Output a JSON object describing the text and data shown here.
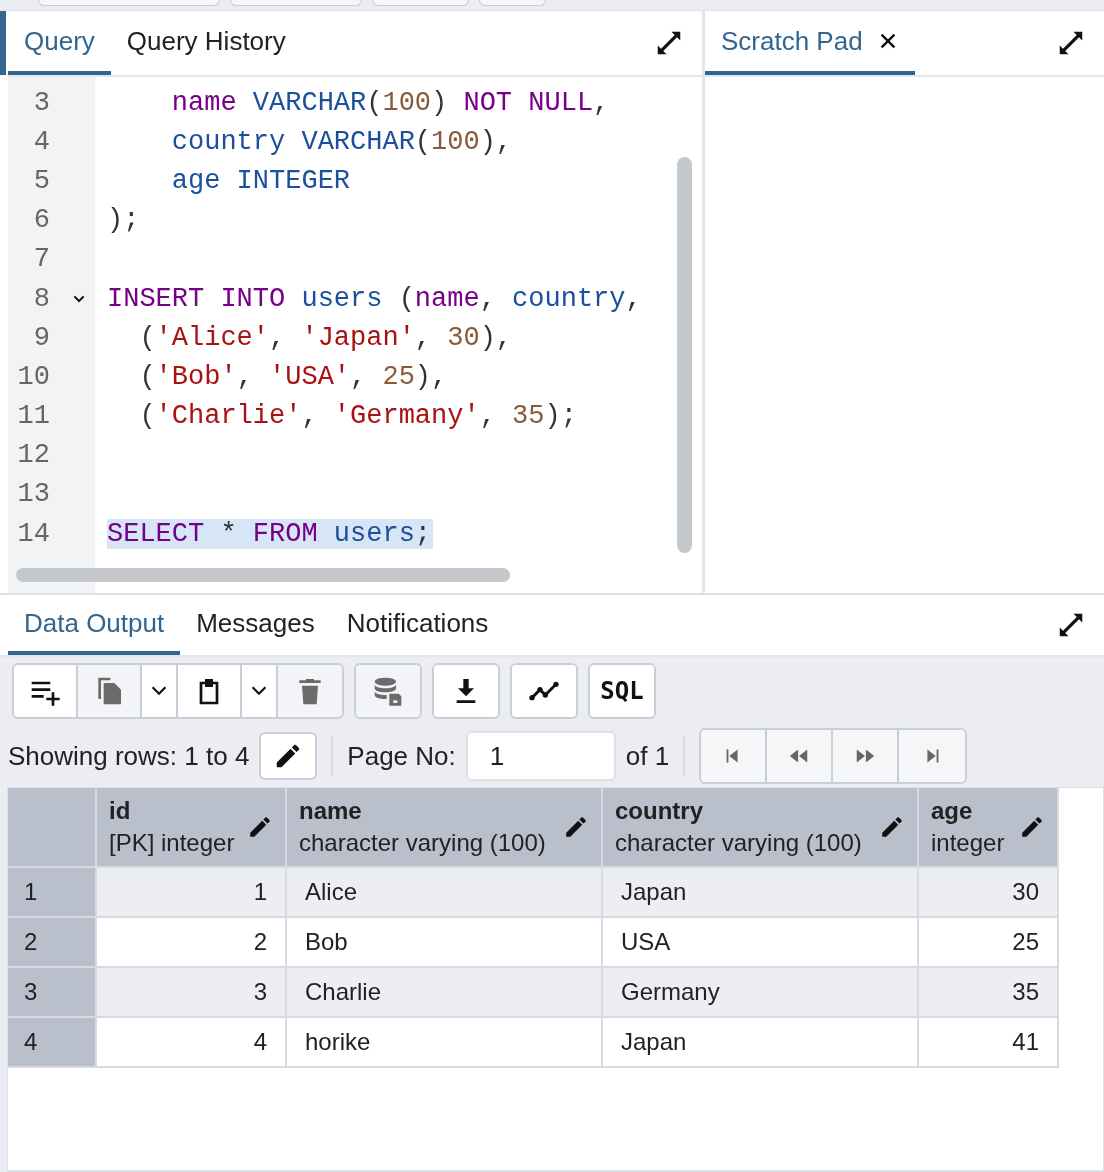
{
  "editor_tabs": [
    {
      "label": "Query",
      "selected": true
    },
    {
      "label": "Query History",
      "selected": false
    }
  ],
  "scratch_tab": {
    "label": "Scratch Pad",
    "selected": true
  },
  "code_lines": [
    {
      "number": "3",
      "tokens": [
        {
          "text": "    name",
          "kind": "keyword"
        },
        {
          "text": " VARCHAR",
          "kind": "type"
        },
        {
          "text": "(",
          "kind": "plain"
        },
        {
          "text": "100",
          "kind": "number"
        },
        {
          "text": ")",
          "kind": "plain"
        },
        {
          "text": " NOT",
          "kind": "keyword"
        },
        {
          "text": " NULL",
          "kind": "keyword"
        },
        {
          "text": ",",
          "kind": "plain"
        }
      ]
    },
    {
      "number": "4",
      "tokens": [
        {
          "text": "    country",
          "kind": "type"
        },
        {
          "text": " VARCHAR",
          "kind": "type"
        },
        {
          "text": "(",
          "kind": "plain"
        },
        {
          "text": "100",
          "kind": "number"
        },
        {
          "text": "),",
          "kind": "plain"
        }
      ]
    },
    {
      "number": "5",
      "tokens": [
        {
          "text": "    age",
          "kind": "type"
        },
        {
          "text": " INTEGER",
          "kind": "type"
        }
      ]
    },
    {
      "number": "6",
      "tokens": [
        {
          "text": ");",
          "kind": "plain"
        }
      ]
    },
    {
      "number": "7"
    },
    {
      "number": "8",
      "fold": true,
      "tokens": [
        {
          "text": "INSERT",
          "kind": "keyword"
        },
        {
          "text": " INTO",
          "kind": "keyword"
        },
        {
          "text": " users",
          "kind": "type"
        },
        {
          "text": " (",
          "kind": "plain"
        },
        {
          "text": "name",
          "kind": "keyword"
        },
        {
          "text": ",",
          "kind": "plain"
        },
        {
          "text": " country",
          "kind": "type"
        },
        {
          "text": ",",
          "kind": "plain"
        }
      ]
    },
    {
      "number": "9",
      "tokens": [
        {
          "text": "  (",
          "kind": "plain"
        },
        {
          "text": "'Alice'",
          "kind": "string"
        },
        {
          "text": ",",
          "kind": "plain"
        },
        {
          "text": " 'Japan'",
          "kind": "string"
        },
        {
          "text": ",",
          "kind": "plain"
        },
        {
          "text": " 30",
          "kind": "number"
        },
        {
          "text": "),",
          "kind": "plain"
        }
      ]
    },
    {
      "number": "10",
      "tokens": [
        {
          "text": "  (",
          "kind": "plain"
        },
        {
          "text": "'Bob'",
          "kind": "string"
        },
        {
          "text": ",",
          "kind": "plain"
        },
        {
          "text": " 'USA'",
          "kind": "string"
        },
        {
          "text": ",",
          "kind": "plain"
        },
        {
          "text": " 25",
          "kind": "number"
        },
        {
          "text": "),",
          "kind": "plain"
        }
      ]
    },
    {
      "number": "11",
      "tokens": [
        {
          "text": "  (",
          "kind": "plain"
        },
        {
          "text": "'Charlie'",
          "kind": "string"
        },
        {
          "text": ",",
          "kind": "plain"
        },
        {
          "text": " 'Germany'",
          "kind": "string"
        },
        {
          "text": ",",
          "kind": "plain"
        },
        {
          "text": " 35",
          "kind": "number"
        },
        {
          "text": ");",
          "kind": "plain"
        }
      ]
    },
    {
      "number": "12"
    },
    {
      "number": "13"
    },
    {
      "number": "14",
      "highlighted": true,
      "tokens": [
        {
          "text": "SELECT",
          "kind": "keyword"
        },
        {
          "text": " *",
          "kind": "plain"
        },
        {
          "text": " FROM",
          "kind": "keyword"
        },
        {
          "text": " users",
          "kind": "type"
        },
        {
          "text": ";",
          "kind": "plain"
        }
      ]
    }
  ],
  "output_tabs": [
    {
      "label": "Data Output",
      "selected": true
    },
    {
      "label": "Messages",
      "selected": false
    },
    {
      "label": "Notifications",
      "selected": false
    }
  ],
  "toolbar": [
    [
      {
        "kind": "add-row",
        "disabled": false
      },
      {
        "kind": "copy",
        "disabled": true
      },
      {
        "kind": "dropdown",
        "disabled": false
      },
      {
        "kind": "paste",
        "disabled": false
      },
      {
        "kind": "dropdown",
        "disabled": false
      },
      {
        "kind": "delete",
        "disabled": true
      }
    ],
    [
      {
        "kind": "save-data",
        "disabled": true
      }
    ],
    [
      {
        "kind": "download",
        "disabled": false
      }
    ],
    [
      {
        "kind": "graph",
        "disabled": false
      }
    ],
    [
      {
        "kind": "sql",
        "label": "SQL",
        "disabled": false
      }
    ]
  ],
  "rows_info": "Showing rows: 1 to 4",
  "page_label": "Page No:",
  "page_value": "1",
  "page_total": "of 1",
  "pagination": [
    {
      "kind": "first",
      "disabled": true
    },
    {
      "kind": "prev",
      "disabled": true
    },
    {
      "kind": "next",
      "disabled": true
    },
    {
      "kind": "last",
      "disabled": true
    }
  ],
  "table": {
    "columns": [
      {
        "name": "id",
        "type": "[PK] integer",
        "kind": "numeric"
      },
      {
        "name": "name",
        "type": "character varying (100)",
        "kind": "text"
      },
      {
        "name": "country",
        "type": "character varying (100)",
        "kind": "text"
      },
      {
        "name": "age",
        "type": "integer",
        "kind": "numeric"
      }
    ],
    "rows": [
      {
        "number": "1",
        "cells": [
          "1",
          "Alice",
          "Japan",
          "30"
        ]
      },
      {
        "number": "2",
        "cells": [
          "2",
          "Bob",
          "USA",
          "25"
        ]
      },
      {
        "number": "3",
        "cells": [
          "3",
          "Charlie",
          "Germany",
          "35"
        ]
      },
      {
        "number": "4",
        "cells": [
          "4",
          "horike",
          "Japan",
          "41"
        ]
      }
    ]
  }
}
